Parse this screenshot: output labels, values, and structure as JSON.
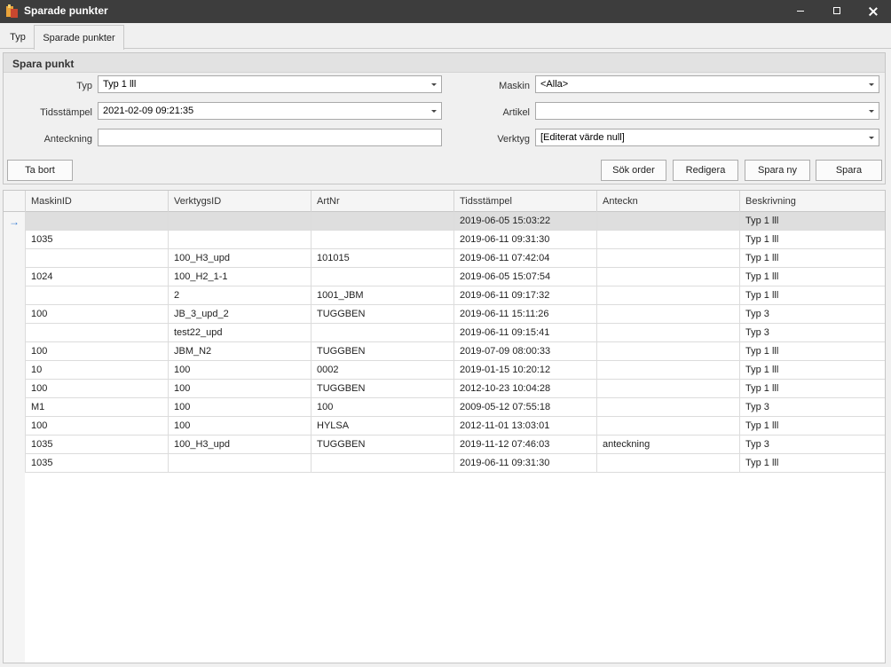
{
  "window": {
    "title": "Sparade punkter"
  },
  "tabs": [
    {
      "label": "Typ"
    },
    {
      "label": "Sparade punkter"
    }
  ],
  "form": {
    "section_title": "Spara punkt",
    "typ": {
      "label": "Typ",
      "value": "Typ 1 lll"
    },
    "tidsstampel": {
      "label": "Tidsstämpel",
      "value": "2021-02-09 09:21:35"
    },
    "anteckning": {
      "label": "Anteckning",
      "value": ""
    },
    "maskin": {
      "label": "Maskin",
      "value": "<Alla>"
    },
    "artikel": {
      "label": "Artikel",
      "value": ""
    },
    "verktyg": {
      "label": "Verktyg",
      "value": "[Editerat värde null]"
    },
    "buttons": {
      "ta_bort": "Ta bort",
      "sok_order": "Sök order",
      "redigera": "Redigera",
      "spara_ny": "Spara ny",
      "spara": "Spara"
    }
  },
  "grid": {
    "columns": [
      "MaskinID",
      "VerktygsID",
      "ArtNr",
      "Tidsstämpel",
      "Anteckn",
      "Beskrivning"
    ],
    "rows": [
      [
        "",
        "",
        "",
        "2019-06-05 15:03:22",
        "",
        "Typ 1 lll"
      ],
      [
        "1035",
        "",
        "",
        "2019-06-11 09:31:30",
        "",
        "Typ 1 lll"
      ],
      [
        "",
        "100_H3_upd",
        "101015",
        "2019-06-11 07:42:04",
        "",
        "Typ 1 lll"
      ],
      [
        "1024",
        "100_H2_1-1",
        "",
        "2019-06-05 15:07:54",
        "",
        "Typ 1 lll"
      ],
      [
        "",
        "2",
        "1001_JBM",
        "2019-06-11 09:17:32",
        "",
        "Typ 1 lll"
      ],
      [
        "100",
        "JB_3_upd_2",
        "TUGGBEN",
        "2019-06-11 15:11:26",
        "",
        "Typ 3"
      ],
      [
        "",
        "test22_upd",
        "",
        "2019-06-11 09:15:41",
        "",
        "Typ 3"
      ],
      [
        "100",
        "JBM_N2",
        "TUGGBEN",
        "2019-07-09 08:00:33",
        "",
        "Typ 1 lll"
      ],
      [
        "10",
        "100",
        "0002",
        "2019-01-15 10:20:12",
        "",
        "Typ 1 lll"
      ],
      [
        "100",
        "100",
        "TUGGBEN",
        "2012-10-23 10:04:28",
        "",
        "Typ 1 lll"
      ],
      [
        "M1",
        "100",
        "100",
        "2009-05-12 07:55:18",
        "",
        "Typ 3"
      ],
      [
        "100",
        "100",
        "HYLSA",
        "2012-11-01 13:03:01",
        "",
        "Typ 1 lll"
      ],
      [
        "1035",
        "100_H3_upd",
        "TUGGBEN",
        "2019-11-12 07:46:03",
        "anteckning",
        "Typ 3"
      ],
      [
        "1035",
        "",
        "",
        "2019-06-11 09:31:30",
        "",
        "Typ 1 lll"
      ]
    ]
  }
}
